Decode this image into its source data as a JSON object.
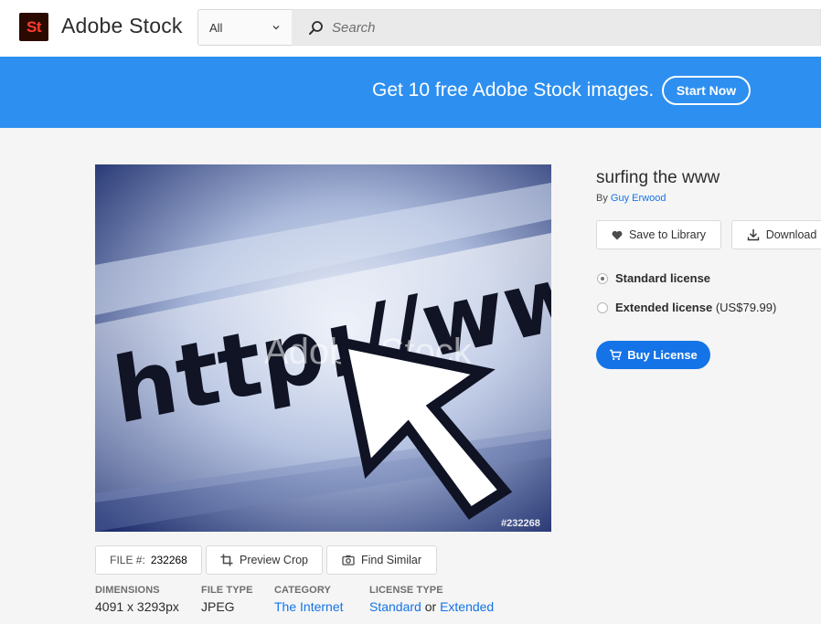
{
  "header": {
    "logo_text": "St",
    "brand_name": "Adobe Stock",
    "filter_value": "All",
    "search_placeholder": "Search"
  },
  "banner": {
    "text": "Get 10 free Adobe Stock images.",
    "cta_label": "Start Now"
  },
  "image": {
    "url_text": "http://www",
    "watermark": "Adobe Stock",
    "id_tag": "#232268"
  },
  "asset": {
    "title": "surfing the www",
    "by_prefix": "By",
    "author": "Guy Erwood",
    "save_label": "Save to Library",
    "download_label": "Download",
    "licenses": [
      {
        "name": "Standard license",
        "price": "",
        "selected": true
      },
      {
        "name": "Extended license",
        "price": "(US$79.99)",
        "selected": false
      }
    ],
    "buy_label": "Buy License"
  },
  "file_bar": {
    "file_label": "FILE #:",
    "file_number": "232268",
    "preview_crop_label": "Preview Crop",
    "find_similar_label": "Find Similar"
  },
  "meta": {
    "dimensions": {
      "heading": "DIMENSIONS",
      "value": "4091 x 3293px"
    },
    "file_type": {
      "heading": "FILE TYPE",
      "value": "JPEG"
    },
    "category": {
      "heading": "CATEGORY",
      "value": "The Internet"
    },
    "license_type": {
      "heading": "LICENSE TYPE",
      "standard": "Standard",
      "or": "or",
      "extended": "Extended"
    }
  },
  "colors": {
    "banner": "#2d8ff0",
    "accent": "#1473e6",
    "logo_bg": "#2a0a00",
    "logo_fg": "#ff3d2e"
  }
}
